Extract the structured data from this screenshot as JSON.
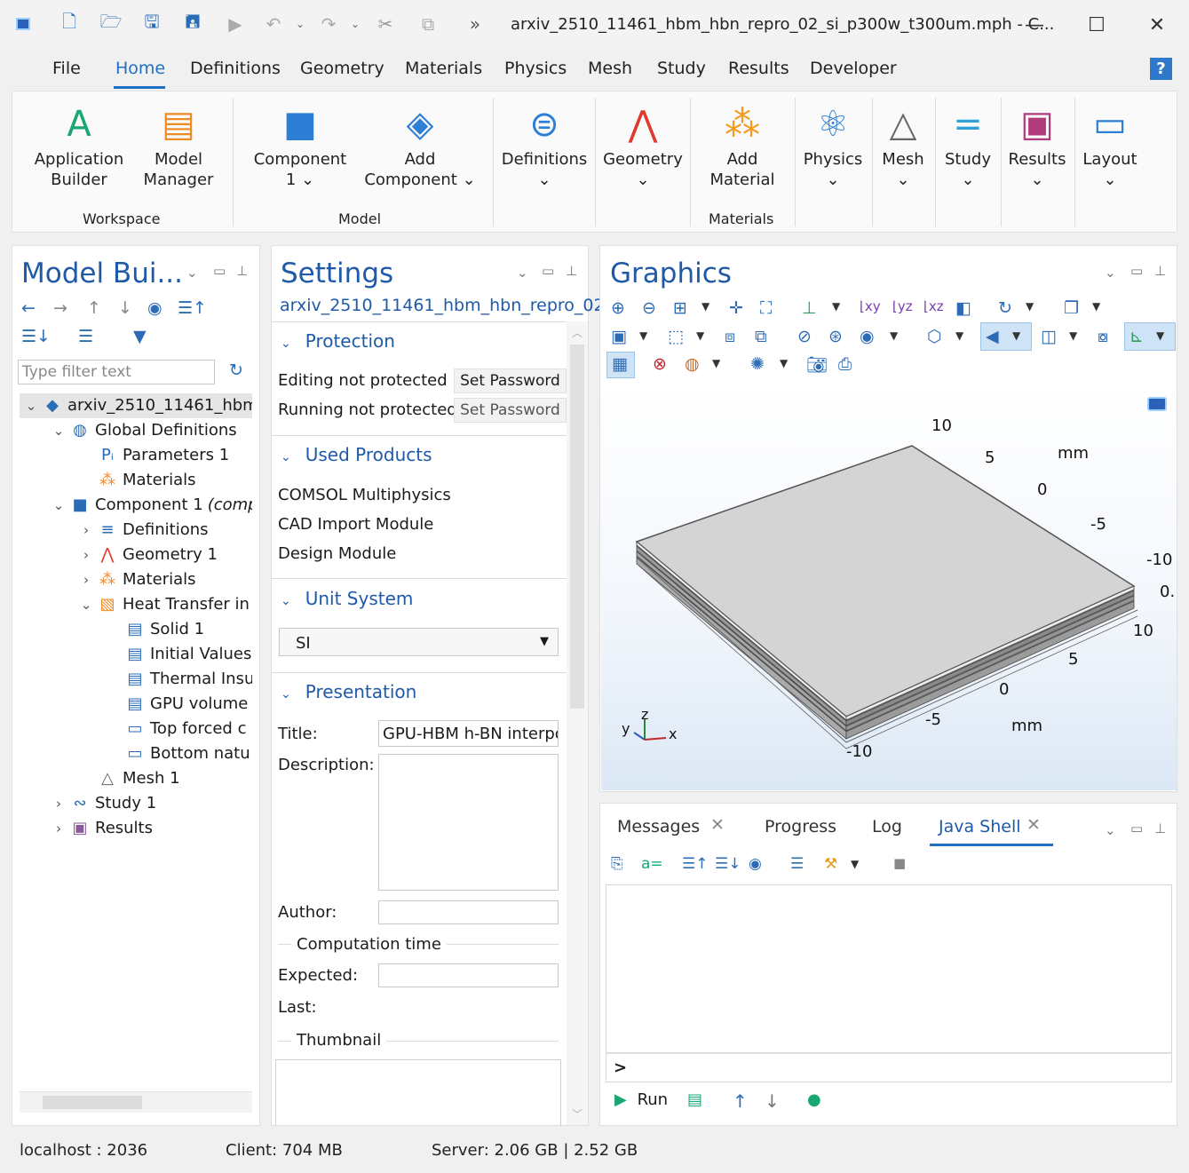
{
  "window": {
    "title": "arxiv_2510_11461_hbm_hbn_repro_02_si_p300w_t300um.mph - C...",
    "minimize": "—",
    "maximize": "☐",
    "close": "✕"
  },
  "quick_access": [
    "new-file-icon",
    "open-folder-icon",
    "save-icon",
    "save-as-icon",
    "run-icon",
    "undo-icon",
    "redo-icon",
    "cut-icon",
    "copy-icon",
    "more-icon"
  ],
  "menu": {
    "items": [
      "File",
      "Home",
      "Definitions",
      "Geometry",
      "Materials",
      "Physics",
      "Mesh",
      "Study",
      "Results",
      "Developer"
    ],
    "active": "Home",
    "help": "?"
  },
  "ribbon": {
    "buttons": [
      {
        "line1": "Application",
        "line2": "Builder"
      },
      {
        "line1": "Model",
        "line2": "Manager"
      },
      {
        "line1": "Component",
        "line2": "1 ⌄"
      },
      {
        "line1": "Add",
        "line2": "Component ⌄"
      },
      {
        "line1": "Definitions",
        "line2": "⌄"
      },
      {
        "line1": "Geometry",
        "line2": "⌄"
      },
      {
        "line1": "Add",
        "line2": "Material"
      },
      {
        "line1": "Physics",
        "line2": "⌄"
      },
      {
        "line1": "Mesh",
        "line2": "⌄"
      },
      {
        "line1": "Study",
        "line2": "⌄"
      },
      {
        "line1": "Results",
        "line2": "⌄"
      },
      {
        "line1": "Layout",
        "line2": "⌄"
      }
    ],
    "groups": {
      "workspace": "Workspace",
      "model": "Model",
      "materials": "Materials"
    }
  },
  "model_builder": {
    "title": "Model Bui...",
    "filter_placeholder": "Type filter text",
    "tree": [
      {
        "label": "arxiv_2510_11461_hbm_h",
        "arrow": "⌄",
        "icon": "root-icon"
      },
      {
        "label": "Global Definitions",
        "arrow": "⌄",
        "icon": "globe-icon"
      },
      {
        "label": "Parameters 1",
        "arrow": "",
        "icon": "parameters-icon"
      },
      {
        "label": "Materials",
        "arrow": "",
        "icon": "materials-icon"
      },
      {
        "label": "Component 1",
        "italic": "(comp",
        "arrow": "⌄",
        "icon": "component-icon"
      },
      {
        "label": "Definitions",
        "arrow": "›",
        "icon": "definitions-icon"
      },
      {
        "label": "Geometry 1",
        "arrow": "›",
        "icon": "geometry-icon"
      },
      {
        "label": "Materials",
        "arrow": "›",
        "icon": "materials-icon"
      },
      {
        "label": "Heat Transfer in",
        "arrow": "⌄",
        "icon": "heat-transfer-icon"
      },
      {
        "label": "Solid 1",
        "arrow": "",
        "icon": "solid-icon"
      },
      {
        "label": "Initial Values",
        "arrow": "",
        "icon": "initial-values-icon"
      },
      {
        "label": "Thermal Insu",
        "arrow": "",
        "icon": "thermal-insulation-icon"
      },
      {
        "label": "GPU volume",
        "arrow": "",
        "icon": "heat-source-icon"
      },
      {
        "label": "Top forced c",
        "arrow": "",
        "icon": "boundary-icon"
      },
      {
        "label": "Bottom natu",
        "arrow": "",
        "icon": "boundary-icon"
      },
      {
        "label": "Mesh 1",
        "arrow": "",
        "icon": "mesh-icon"
      },
      {
        "label": "Study 1",
        "arrow": "›",
        "icon": "study-icon"
      },
      {
        "label": "Results",
        "arrow": "›",
        "icon": "results-icon"
      }
    ]
  },
  "settings": {
    "title": "Settings",
    "subtitle": "arxiv_2510_11461_hbm_hbn_repro_02...",
    "protection": {
      "header": "Protection",
      "editing": "Editing not protected",
      "running": "Running not protected",
      "set_password": "Set Password"
    },
    "used_products": {
      "header": "Used Products",
      "items": [
        "COMSOL Multiphysics",
        "CAD Import Module",
        "Design Module"
      ]
    },
    "unit_system": {
      "header": "Unit System",
      "value": "SI"
    },
    "presentation": {
      "header": "Presentation",
      "title_label": "Title:",
      "title_value": "GPU-HBM h-BN interpo",
      "description_label": "Description:",
      "author_label": "Author:",
      "computation_time": "Computation time",
      "expected_label": "Expected:",
      "last_label": "Last:",
      "thumbnail": "Thumbnail"
    }
  },
  "graphics": {
    "title": "Graphics",
    "axis_labels": {
      "back_10": "10",
      "back_5": "5",
      "back_0": "0",
      "back_m5": "-5",
      "back_m10": "-10",
      "back_mm": "mm",
      "z_0": "0.",
      "front_10": "10",
      "front_5": "5",
      "front_0": "0",
      "front_m5": "-5",
      "front_m10": "-10",
      "front_mm": "mm"
    },
    "triad": {
      "x": "x",
      "y": "y",
      "z": "z"
    }
  },
  "messages": {
    "tabs": [
      "Messages",
      "Progress",
      "Log",
      "Java Shell"
    ],
    "active_tab": "Java Shell",
    "prompt": ">",
    "run": "Run"
  },
  "status": {
    "host": "localhost : 2036",
    "client": "Client: 704 MB",
    "server": "Server: 2.06 GB | 2.52 GB"
  }
}
